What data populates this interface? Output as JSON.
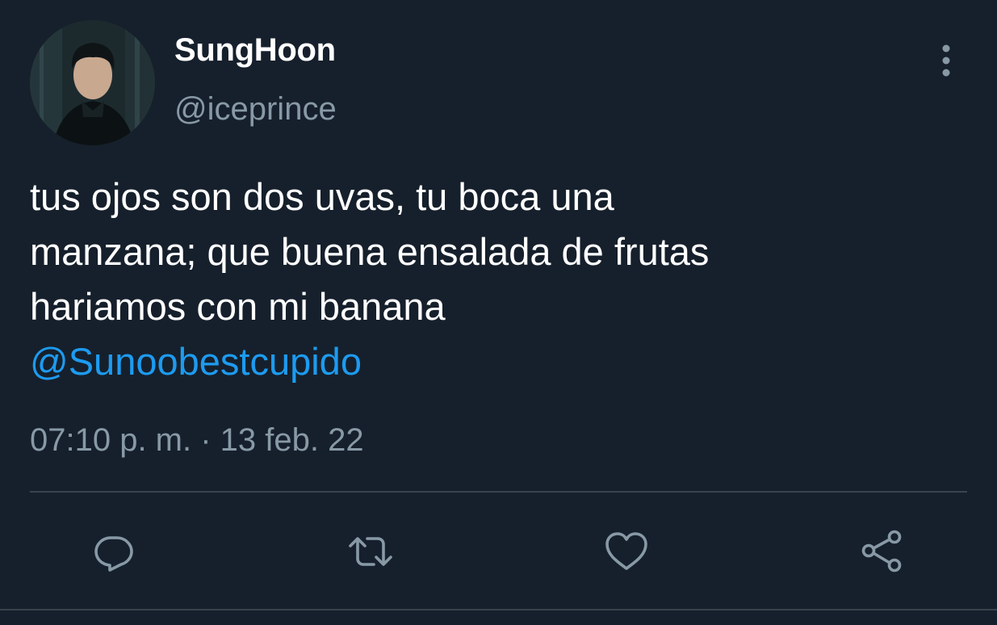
{
  "user": {
    "display_name": "SungHoon",
    "handle": "@iceprince",
    "avatar_icon": "profile-photo"
  },
  "tweet": {
    "text": "tus ojos son dos uvas, tu boca una\nmanzana; que buena ensalada de frutas\nhariamos con mi banana",
    "mention": "@Sunoobestcupido",
    "timestamp": "07:10 p. m. · 13 feb. 22"
  },
  "actions": [
    {
      "name": "reply",
      "icon": "reply-icon"
    },
    {
      "name": "retweet",
      "icon": "retweet-icon"
    },
    {
      "name": "like",
      "icon": "heart-icon"
    },
    {
      "name": "share",
      "icon": "share-icon"
    }
  ],
  "colors": {
    "background": "#16202c",
    "text": "#ffffff",
    "secondary_text": "#8899a6",
    "link": "#1d9bf0",
    "divider": "#38444d"
  }
}
